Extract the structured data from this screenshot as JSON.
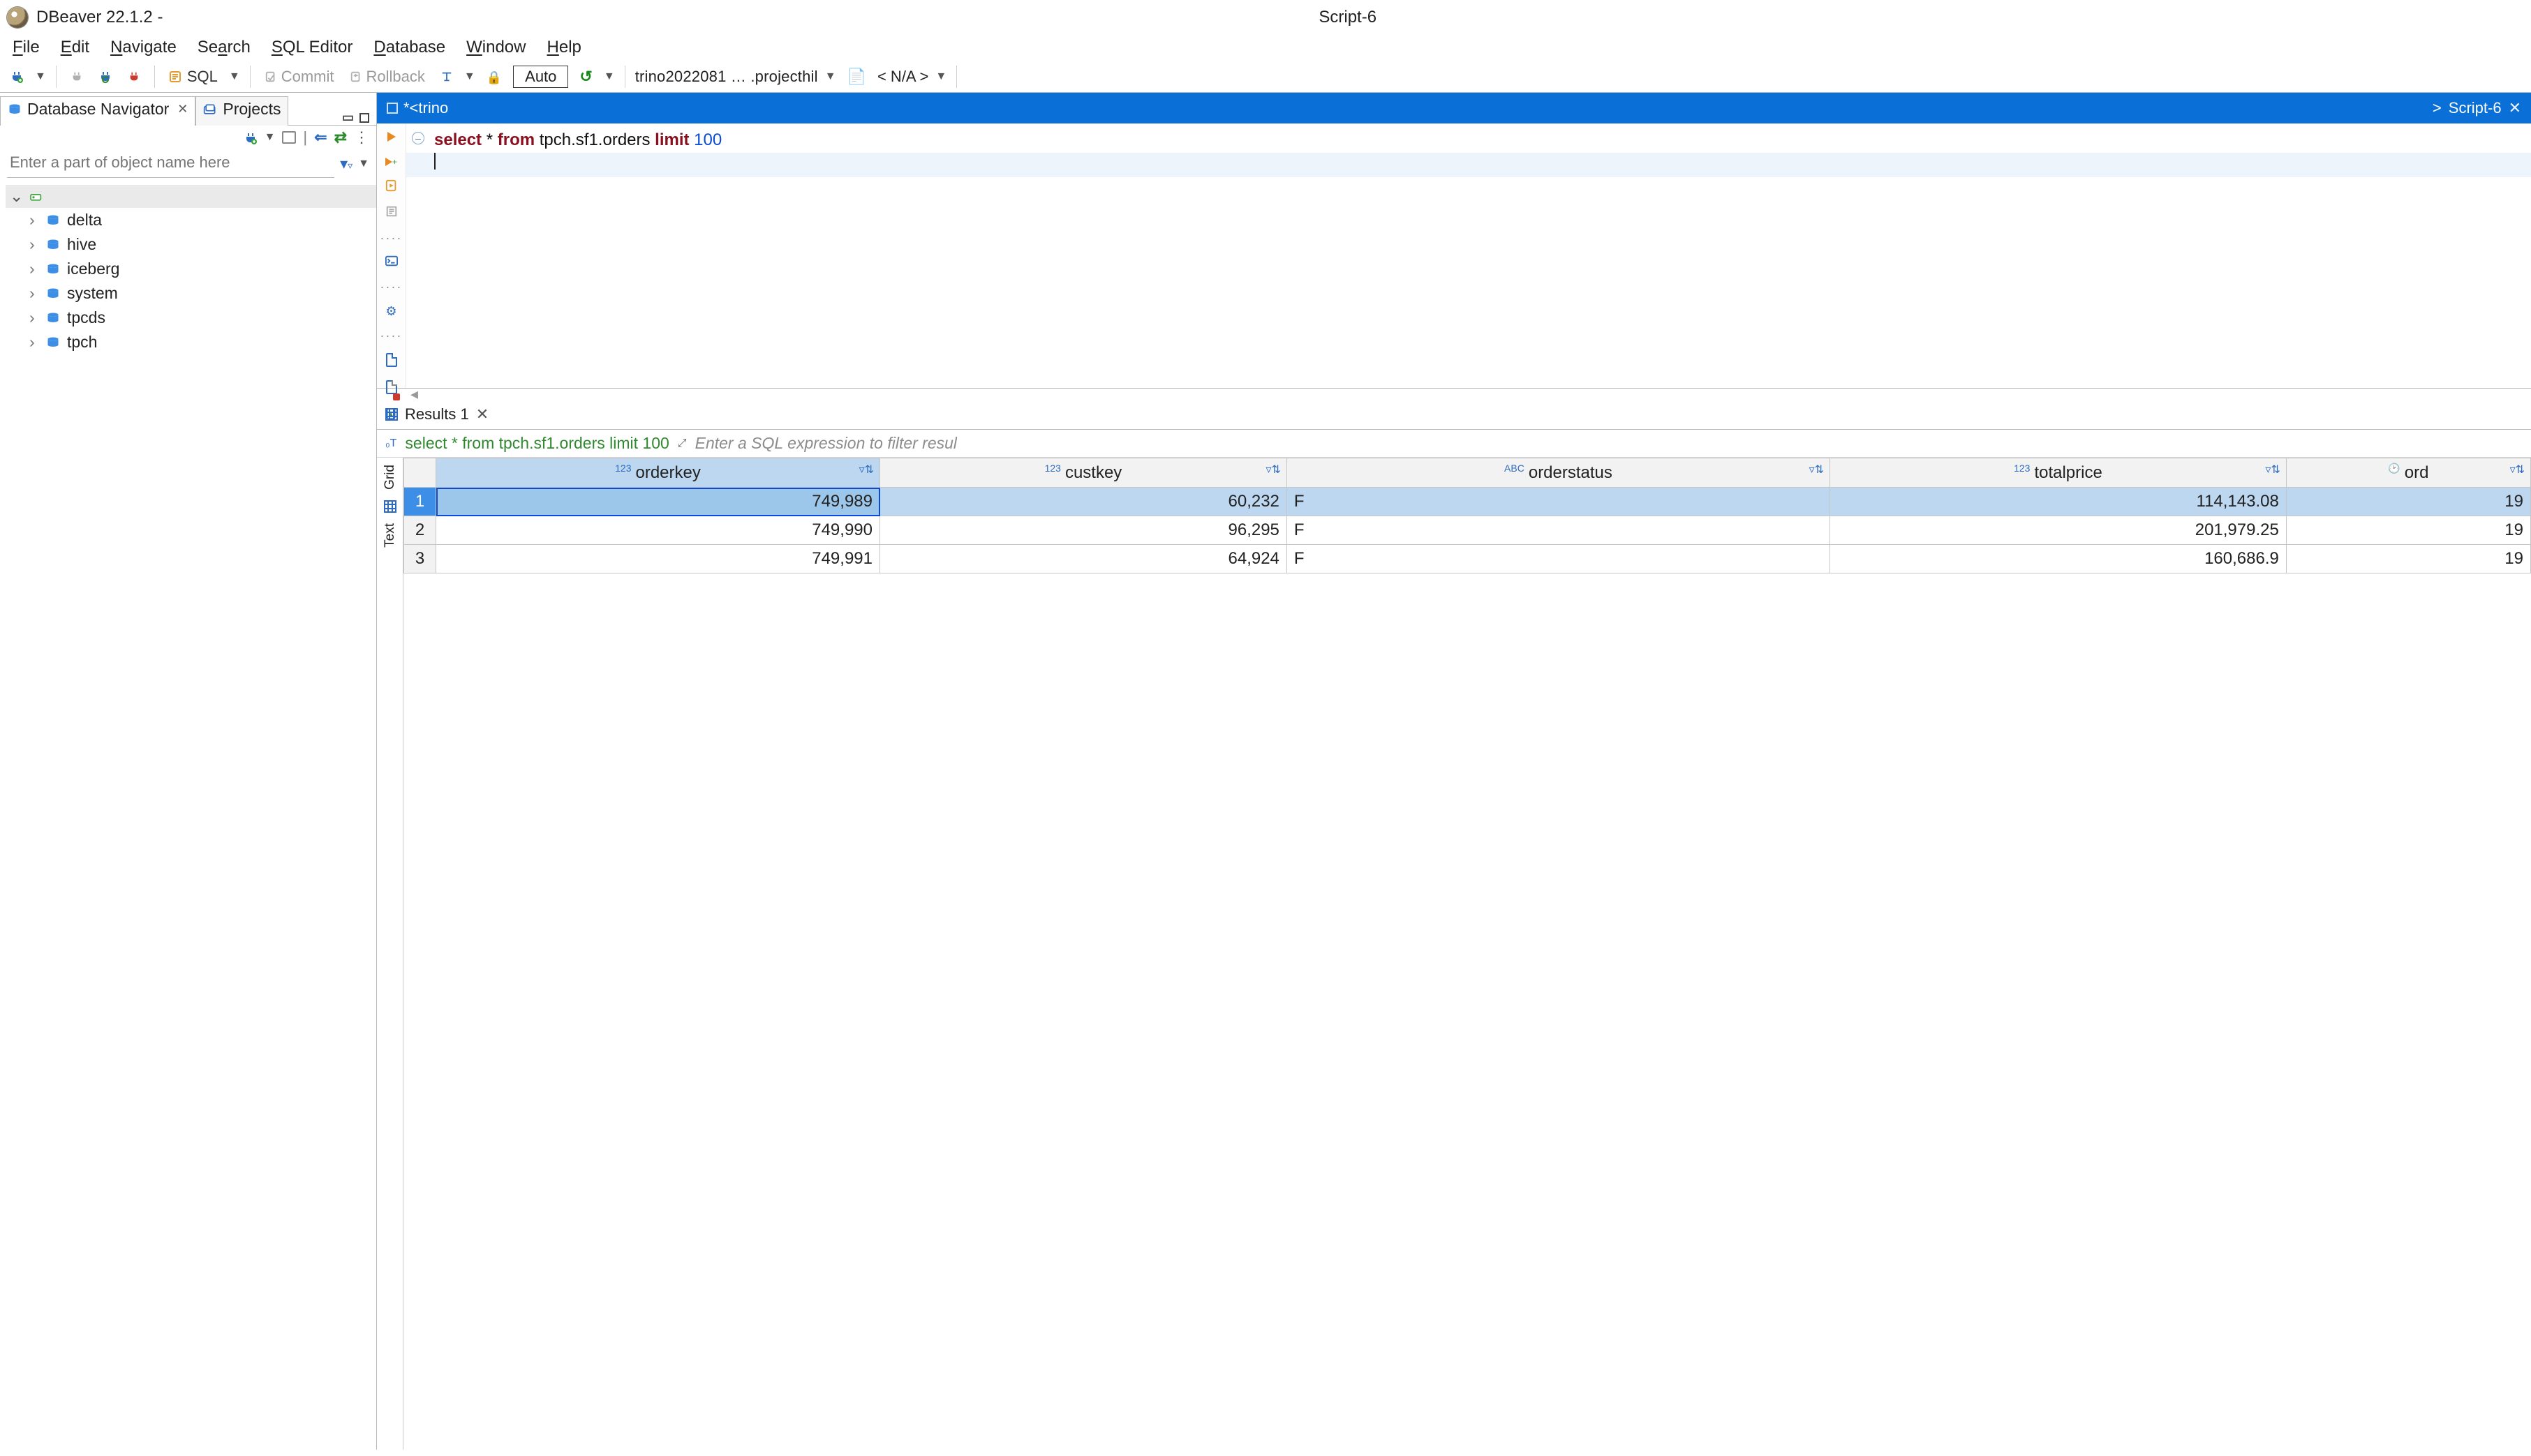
{
  "window": {
    "app_title": "DBeaver 22.1.2 -",
    "document_title": "Script-6"
  },
  "menu": {
    "file": "File",
    "edit": "Edit",
    "navigate": "Navigate",
    "search": "Search",
    "sql_editor": "SQL Editor",
    "database": "Database",
    "window": "Window",
    "help": "Help"
  },
  "toolbar": {
    "sql_label": "SQL",
    "commit_label": "Commit",
    "rollback_label": "Rollback",
    "auto_label": "Auto",
    "connection_label": "trino2022081 … .projecthil",
    "schema_label": "< N/A >"
  },
  "left_panel": {
    "tabs": {
      "navigator": "Database Navigator",
      "projects": "Projects"
    },
    "filter_placeholder": "Enter a part of object name here",
    "tree_items": [
      "delta",
      "hive",
      "iceberg",
      "system",
      "tpcds",
      "tpch"
    ]
  },
  "editor": {
    "tab_left": "*<trino",
    "tab_right_prefix": "> ",
    "tab_right": "Script-6",
    "sql_tokens": {
      "select": "select",
      "star": " * ",
      "from": "from",
      "table": " tpch.sf1.orders ",
      "limit": "limit",
      "n": " 100"
    }
  },
  "results": {
    "tab_label": "Results 1",
    "query_text": "select * from tpch.sf1.orders limit 100",
    "filter_hint": "Enter a SQL expression to filter resul",
    "view_labels": {
      "grid": "Grid",
      "text": "Text"
    },
    "columns": [
      {
        "name": "orderkey",
        "type": "123"
      },
      {
        "name": "custkey",
        "type": "123"
      },
      {
        "name": "orderstatus",
        "type": "ABC"
      },
      {
        "name": "totalprice",
        "type": "123"
      },
      {
        "name": "ord",
        "type": "clock"
      }
    ],
    "rows": [
      {
        "n": "1",
        "orderkey": "749,989",
        "custkey": "60,232",
        "orderstatus": "F",
        "totalprice": "114,143.08",
        "ord": "19"
      },
      {
        "n": "2",
        "orderkey": "749,990",
        "custkey": "96,295",
        "orderstatus": "F",
        "totalprice": "201,979.25",
        "ord": "19"
      },
      {
        "n": "3",
        "orderkey": "749,991",
        "custkey": "64,924",
        "orderstatus": "F",
        "totalprice": "160,686.9",
        "ord": "19"
      }
    ]
  }
}
